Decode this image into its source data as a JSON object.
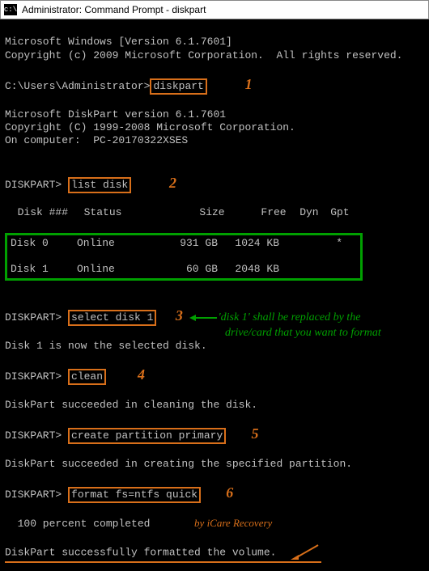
{
  "titlebar": {
    "icon_text": "c:\\",
    "title": "Administrator: Command Prompt - diskpart"
  },
  "lines": {
    "ms_windows": "Microsoft Windows [Version 6.1.7601]",
    "copyright_win": "Copyright (c) 2009 Microsoft Corporation.  All rights reserved.",
    "prompt1_pre": "C:\\Users\\Administrator>",
    "cmd_diskpart": "diskpart",
    "num1": "1",
    "diskpart_ver": "Microsoft DiskPart version 6.1.7601",
    "copyright_dp": "Copyright (C) 1999-2008 Microsoft Corporation.",
    "on_computer": "On computer:  PC-20170322XSES",
    "dp_prompt": "DISKPART> ",
    "cmd_listdisk": "list disk",
    "num2": "2",
    "hdr_disk": "Disk ###",
    "hdr_status": "Status",
    "hdr_size": "Size",
    "hdr_free": "Free",
    "hdr_dyn": "Dyn",
    "hdr_gpt": "Gpt",
    "d0_name": "Disk 0",
    "d0_status": "Online",
    "d0_size": "931 GB",
    "d0_free": "1024 KB",
    "d0_dyn": "",
    "d0_gpt": "*",
    "d1_name": "Disk 1",
    "d1_status": "Online",
    "d1_size": "60 GB",
    "d1_free": "2048 KB",
    "d1_dyn": "",
    "d1_gpt": "",
    "cmd_select": "select disk 1",
    "num3": "3",
    "ann_green_l1": "'disk 1' shall be replaced by the",
    "ann_green_l2": "drive/card that you want to format",
    "selected_msg": "Disk 1 is now the selected disk.",
    "cmd_clean": "clean",
    "num4": "4",
    "clean_msg": "DiskPart succeeded in cleaning the disk.",
    "cmd_create": "create partition primary",
    "num5": "5",
    "create_msg": "DiskPart succeeded in creating the specified partition.",
    "cmd_format": "format fs=ntfs quick",
    "num6": "6",
    "pct_msg": "  100 percent completed",
    "credit": "by iCare Recovery",
    "done_msg": "DiskPart successfully formatted the volume."
  }
}
